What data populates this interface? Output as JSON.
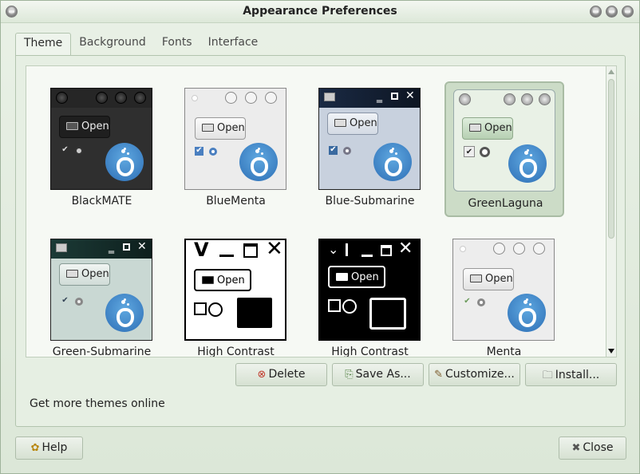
{
  "window": {
    "title": "Appearance Preferences"
  },
  "tabs": [
    {
      "label": "Theme",
      "active": true
    },
    {
      "label": "Background",
      "active": false
    },
    {
      "label": "Fonts",
      "active": false
    },
    {
      "label": "Interface",
      "active": false
    }
  ],
  "themes": [
    {
      "name": "BlackMATE",
      "preview_button": "Open",
      "selected": false
    },
    {
      "name": "BlueMenta",
      "preview_button": "Open",
      "selected": false
    },
    {
      "name": "Blue-Submarine",
      "preview_button": "Open",
      "selected": false
    },
    {
      "name": "GreenLaguna",
      "preview_button": "Open",
      "selected": true
    },
    {
      "name": "Green-Submarine",
      "preview_button": "Open",
      "selected": false
    },
    {
      "name": "High Contrast",
      "preview_button": "Open",
      "selected": false
    },
    {
      "name": "High Contrast",
      "preview_button": "Open",
      "selected": false
    },
    {
      "name": "Menta",
      "preview_button": "Open",
      "selected": false
    }
  ],
  "actions": {
    "delete": "Delete",
    "save_as": "Save As...",
    "customize": "Customize...",
    "install": "Install..."
  },
  "get_more": "Get more themes online",
  "footer": {
    "help": "Help",
    "close": "Close"
  },
  "colors": {
    "window_bg": "#dce7d8",
    "selection": "#ccdcc7",
    "mate_blue": "#2e6fb6"
  }
}
